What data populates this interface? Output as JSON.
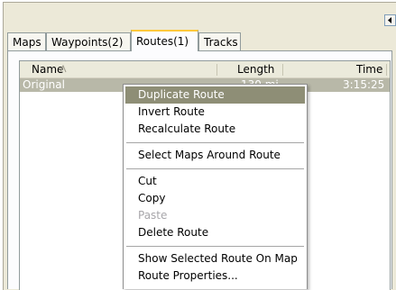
{
  "tabs": [
    {
      "label": "Maps"
    },
    {
      "label": "Waypoints(2)"
    },
    {
      "label": "Routes(1)",
      "active": true
    },
    {
      "label": "Tracks"
    }
  ],
  "list": {
    "columns": {
      "name": "Name",
      "length": "Length",
      "time": "Time"
    },
    "sort_indicator": "sort-ascending-icon",
    "rows": [
      {
        "name": "Original",
        "length": "130 mi",
        "time": "3:15:25",
        "selected": true
      }
    ]
  },
  "context_menu": {
    "items": [
      {
        "label": "Duplicate Route",
        "state": "highlighted"
      },
      {
        "label": "Invert Route"
      },
      {
        "label": "Recalculate Route"
      },
      {
        "label": "Select Maps Around Route"
      },
      {
        "label": "Cut"
      },
      {
        "label": "Copy"
      },
      {
        "label": "Paste",
        "state": "disabled"
      },
      {
        "label": "Delete Route"
      },
      {
        "label": "Show Selected Route On Map"
      },
      {
        "label": "Route Properties..."
      }
    ]
  },
  "colors": {
    "panel_bg": "#ece9d8",
    "active_tab_accent": "#ffc83c",
    "selected_row_bg": "#b8b8a8",
    "menu_highlight_bg": "#8e8e76",
    "disabled_text": "#a7a6aa"
  }
}
